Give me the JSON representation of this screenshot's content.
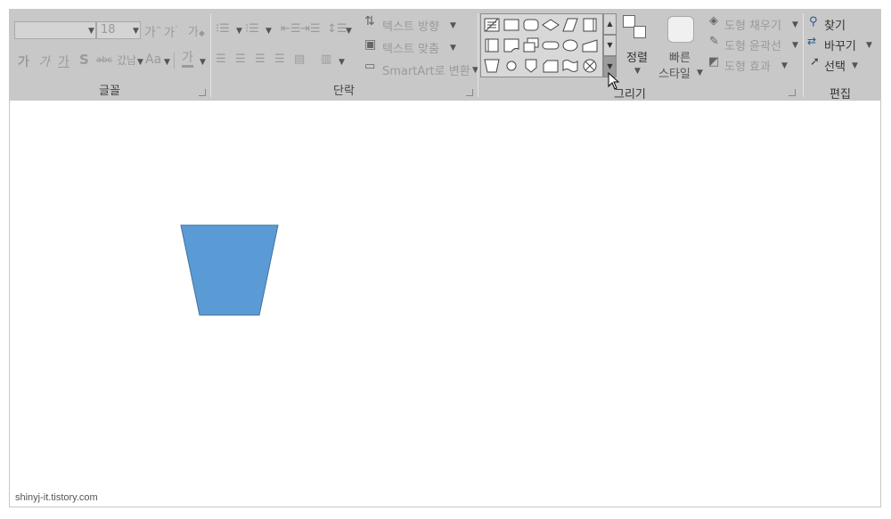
{
  "ribbon": {
    "font_group": {
      "label": "글꼴",
      "font_size_value": "18",
      "grow_label": "가",
      "shrink_label": "가",
      "clear_format_label": "가",
      "bold_label": "가",
      "italic_label": "가",
      "underline_label": "가",
      "shadow_label": "S",
      "strike_label": "abc",
      "spacing_label": "갔남",
      "case_label": "Aa",
      "color_label": "가"
    },
    "paragraph_group": {
      "label": "단락",
      "text_direction_label": "텍스트 방향",
      "align_text_label": "텍스트 맞춤",
      "smartart_label": "SmartArt로 변환"
    },
    "drawing_group": {
      "label": "그리기",
      "arrange_label": "정렬",
      "quick_styles_line1": "빠른",
      "quick_styles_line2": "스타일",
      "shape_fill_label": "도형 채우기",
      "shape_outline_label": "도형 윤곽선",
      "shape_effects_label": "도형 효과"
    },
    "editing_group": {
      "label": "편집",
      "find_label": "찾기",
      "replace_label": "바꾸기",
      "select_label": "선택"
    }
  },
  "canvas": {
    "shape_fill": "#5b9bd5",
    "shape_stroke": "#41719c"
  },
  "watermark": "shinyj-it.tistory.com"
}
